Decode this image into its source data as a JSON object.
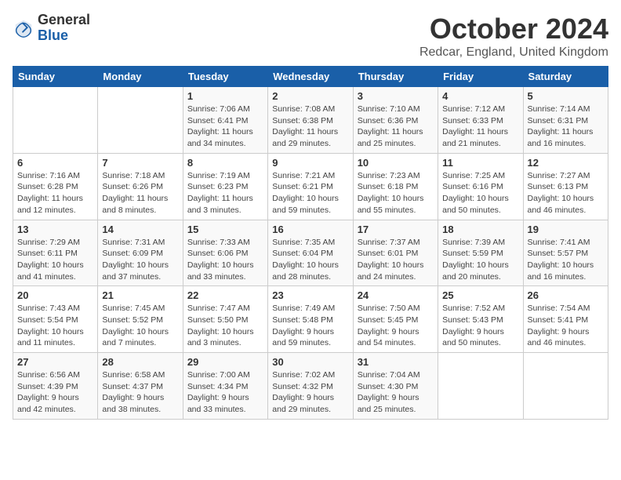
{
  "header": {
    "logo_general": "General",
    "logo_blue": "Blue",
    "month": "October 2024",
    "location": "Redcar, England, United Kingdom"
  },
  "weekdays": [
    "Sunday",
    "Monday",
    "Tuesday",
    "Wednesday",
    "Thursday",
    "Friday",
    "Saturday"
  ],
  "weeks": [
    [
      {
        "day": "",
        "info": ""
      },
      {
        "day": "",
        "info": ""
      },
      {
        "day": "1",
        "info": "Sunrise: 7:06 AM\nSunset: 6:41 PM\nDaylight: 11 hours and 34 minutes."
      },
      {
        "day": "2",
        "info": "Sunrise: 7:08 AM\nSunset: 6:38 PM\nDaylight: 11 hours and 29 minutes."
      },
      {
        "day": "3",
        "info": "Sunrise: 7:10 AM\nSunset: 6:36 PM\nDaylight: 11 hours and 25 minutes."
      },
      {
        "day": "4",
        "info": "Sunrise: 7:12 AM\nSunset: 6:33 PM\nDaylight: 11 hours and 21 minutes."
      },
      {
        "day": "5",
        "info": "Sunrise: 7:14 AM\nSunset: 6:31 PM\nDaylight: 11 hours and 16 minutes."
      }
    ],
    [
      {
        "day": "6",
        "info": "Sunrise: 7:16 AM\nSunset: 6:28 PM\nDaylight: 11 hours and 12 minutes."
      },
      {
        "day": "7",
        "info": "Sunrise: 7:18 AM\nSunset: 6:26 PM\nDaylight: 11 hours and 8 minutes."
      },
      {
        "day": "8",
        "info": "Sunrise: 7:19 AM\nSunset: 6:23 PM\nDaylight: 11 hours and 3 minutes."
      },
      {
        "day": "9",
        "info": "Sunrise: 7:21 AM\nSunset: 6:21 PM\nDaylight: 10 hours and 59 minutes."
      },
      {
        "day": "10",
        "info": "Sunrise: 7:23 AM\nSunset: 6:18 PM\nDaylight: 10 hours and 55 minutes."
      },
      {
        "day": "11",
        "info": "Sunrise: 7:25 AM\nSunset: 6:16 PM\nDaylight: 10 hours and 50 minutes."
      },
      {
        "day": "12",
        "info": "Sunrise: 7:27 AM\nSunset: 6:13 PM\nDaylight: 10 hours and 46 minutes."
      }
    ],
    [
      {
        "day": "13",
        "info": "Sunrise: 7:29 AM\nSunset: 6:11 PM\nDaylight: 10 hours and 41 minutes."
      },
      {
        "day": "14",
        "info": "Sunrise: 7:31 AM\nSunset: 6:09 PM\nDaylight: 10 hours and 37 minutes."
      },
      {
        "day": "15",
        "info": "Sunrise: 7:33 AM\nSunset: 6:06 PM\nDaylight: 10 hours and 33 minutes."
      },
      {
        "day": "16",
        "info": "Sunrise: 7:35 AM\nSunset: 6:04 PM\nDaylight: 10 hours and 28 minutes."
      },
      {
        "day": "17",
        "info": "Sunrise: 7:37 AM\nSunset: 6:01 PM\nDaylight: 10 hours and 24 minutes."
      },
      {
        "day": "18",
        "info": "Sunrise: 7:39 AM\nSunset: 5:59 PM\nDaylight: 10 hours and 20 minutes."
      },
      {
        "day": "19",
        "info": "Sunrise: 7:41 AM\nSunset: 5:57 PM\nDaylight: 10 hours and 16 minutes."
      }
    ],
    [
      {
        "day": "20",
        "info": "Sunrise: 7:43 AM\nSunset: 5:54 PM\nDaylight: 10 hours and 11 minutes."
      },
      {
        "day": "21",
        "info": "Sunrise: 7:45 AM\nSunset: 5:52 PM\nDaylight: 10 hours and 7 minutes."
      },
      {
        "day": "22",
        "info": "Sunrise: 7:47 AM\nSunset: 5:50 PM\nDaylight: 10 hours and 3 minutes."
      },
      {
        "day": "23",
        "info": "Sunrise: 7:49 AM\nSunset: 5:48 PM\nDaylight: 9 hours and 59 minutes."
      },
      {
        "day": "24",
        "info": "Sunrise: 7:50 AM\nSunset: 5:45 PM\nDaylight: 9 hours and 54 minutes."
      },
      {
        "day": "25",
        "info": "Sunrise: 7:52 AM\nSunset: 5:43 PM\nDaylight: 9 hours and 50 minutes."
      },
      {
        "day": "26",
        "info": "Sunrise: 7:54 AM\nSunset: 5:41 PM\nDaylight: 9 hours and 46 minutes."
      }
    ],
    [
      {
        "day": "27",
        "info": "Sunrise: 6:56 AM\nSunset: 4:39 PM\nDaylight: 9 hours and 42 minutes."
      },
      {
        "day": "28",
        "info": "Sunrise: 6:58 AM\nSunset: 4:37 PM\nDaylight: 9 hours and 38 minutes."
      },
      {
        "day": "29",
        "info": "Sunrise: 7:00 AM\nSunset: 4:34 PM\nDaylight: 9 hours and 33 minutes."
      },
      {
        "day": "30",
        "info": "Sunrise: 7:02 AM\nSunset: 4:32 PM\nDaylight: 9 hours and 29 minutes."
      },
      {
        "day": "31",
        "info": "Sunrise: 7:04 AM\nSunset: 4:30 PM\nDaylight: 9 hours and 25 minutes."
      },
      {
        "day": "",
        "info": ""
      },
      {
        "day": "",
        "info": ""
      }
    ]
  ]
}
